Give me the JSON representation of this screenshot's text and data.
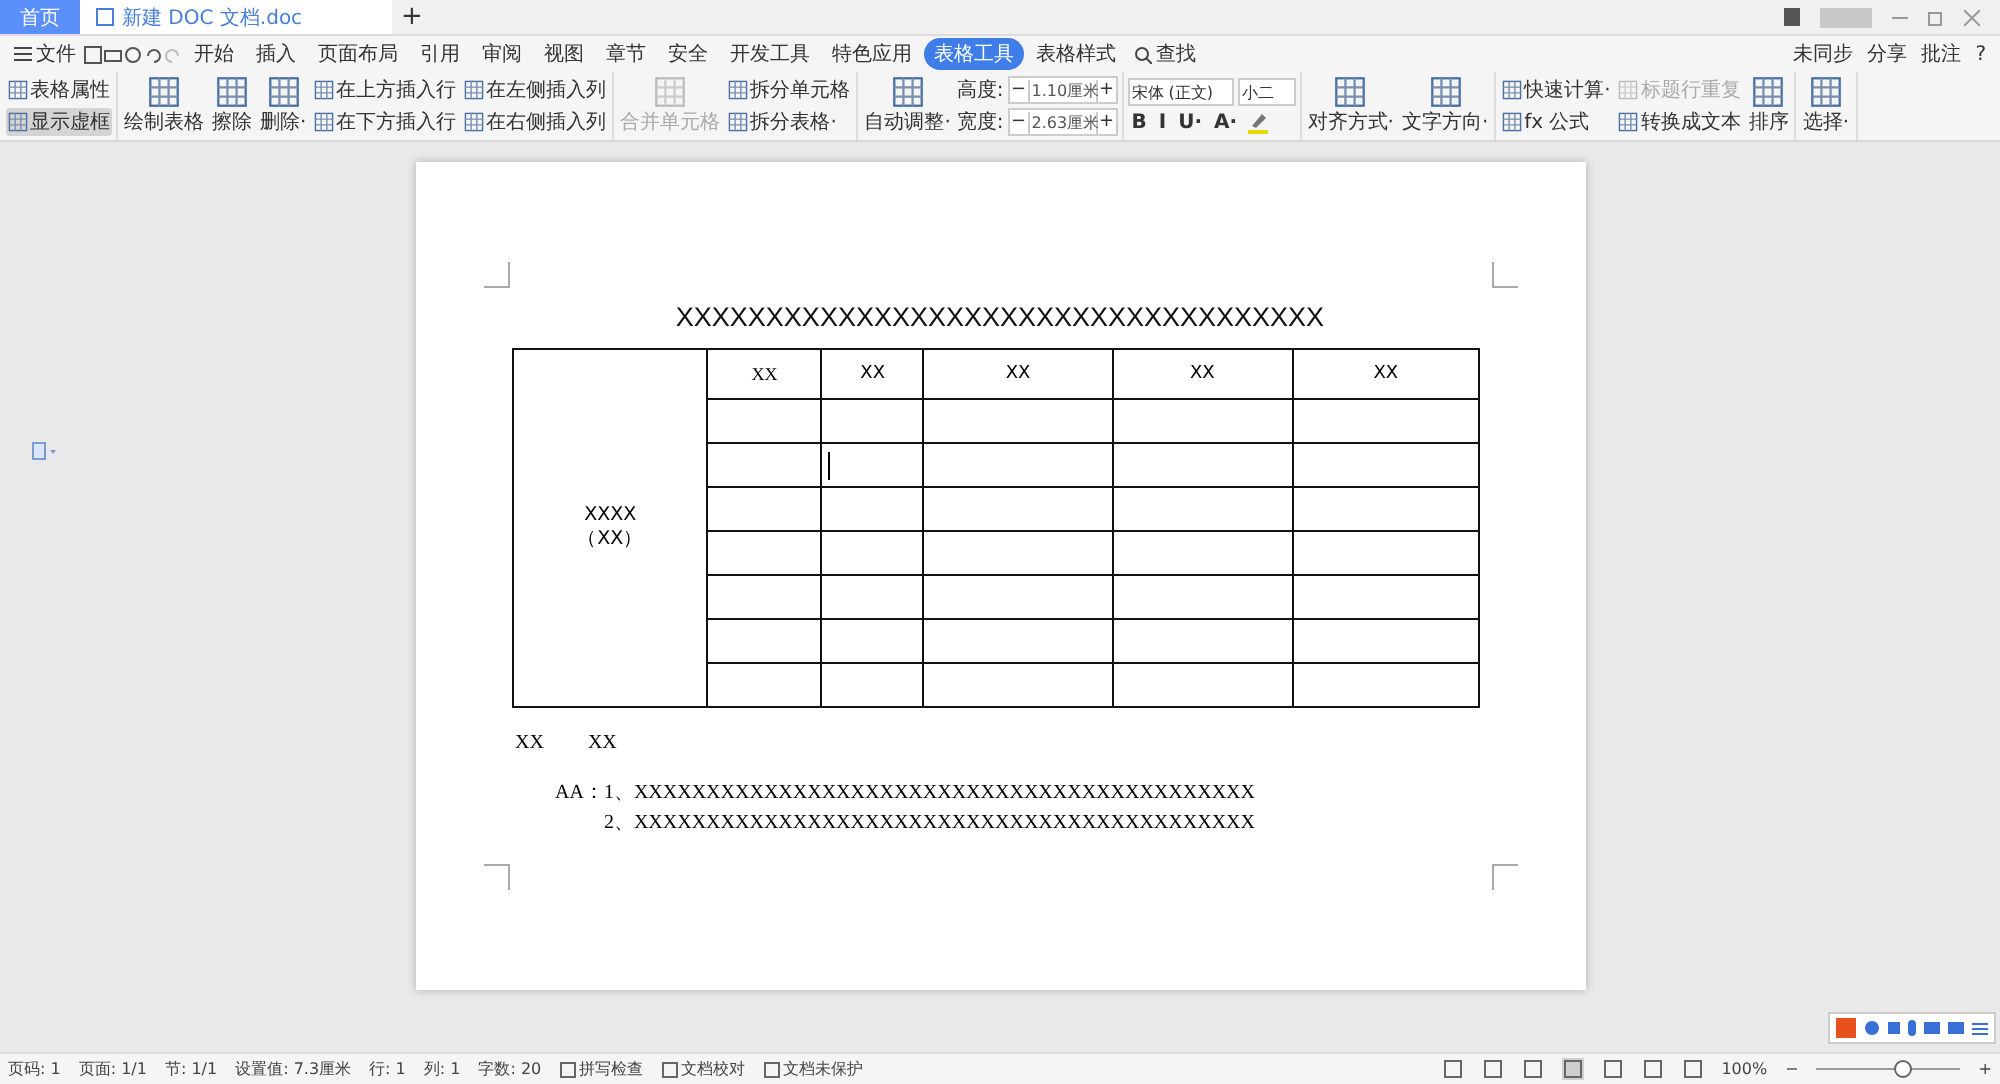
{
  "title_tabs": [
    {
      "label": "首页",
      "kind": "home",
      "selected": false
    },
    {
      "label": "新建 DOC 文档.doc",
      "kind": "doc",
      "selected": true
    }
  ],
  "new_tab": "+",
  "menu": {
    "file": "文件",
    "tabs": [
      {
        "label": "开始",
        "selected": false
      },
      {
        "label": "插入",
        "selected": false
      },
      {
        "label": "页面布局",
        "selected": false
      },
      {
        "label": "引用",
        "selected": false
      },
      {
        "label": "审阅",
        "selected": false
      },
      {
        "label": "视图",
        "selected": false
      },
      {
        "label": "章节",
        "selected": false
      },
      {
        "label": "安全",
        "selected": false
      },
      {
        "label": "开发工具",
        "selected": false
      },
      {
        "label": "特色应用",
        "selected": false
      },
      {
        "label": "表格工具",
        "selected": true
      },
      {
        "label": "表格样式",
        "selected": false
      }
    ],
    "search": "查找",
    "right": [
      "未同步",
      "分享",
      "批注"
    ],
    "help": "?"
  },
  "ribbon": [
    {
      "columns": [
        {
          "kind": "stack",
          "items": [
            {
              "label": "表格属性",
              "disabled": false,
              "pressed": false
            },
            {
              "label": "显示虚框",
              "disabled": false,
              "pressed": true
            }
          ]
        }
      ]
    },
    {
      "columns": [
        {
          "kind": "large",
          "items": [
            {
              "label": "绘制表格",
              "disabled": false,
              "pressed": false
            }
          ]
        },
        {
          "kind": "large",
          "items": [
            {
              "label": "擦除",
              "disabled": false,
              "pressed": false
            }
          ]
        },
        {
          "kind": "large",
          "items": [
            {
              "label": "删除·",
              "disabled": false,
              "pressed": false
            }
          ]
        },
        {
          "kind": "stack",
          "items": [
            {
              "label": "在上方插入行",
              "disabled": false,
              "pressed": false
            },
            {
              "label": "在下方插入行",
              "disabled": false,
              "pressed": false
            }
          ]
        },
        {
          "kind": "stack",
          "items": [
            {
              "label": "在左侧插入列",
              "disabled": false,
              "pressed": false
            },
            {
              "label": "在右侧插入列",
              "disabled": false,
              "pressed": false
            }
          ]
        }
      ]
    },
    {
      "columns": [
        {
          "kind": "large",
          "items": [
            {
              "label": "合并单元格",
              "disabled": true,
              "pressed": false
            }
          ]
        },
        {
          "kind": "stack",
          "items": [
            {
              "label": "拆分单元格",
              "disabled": false,
              "pressed": false
            },
            {
              "label": "拆分表格·",
              "disabled": false,
              "pressed": false
            }
          ]
        }
      ]
    },
    {
      "columns": [
        {
          "kind": "large",
          "items": [
            {
              "label": "自动调整·",
              "disabled": false,
              "pressed": false
            }
          ]
        },
        {
          "kind": "spinners",
          "items": [
            {
              "label": "高度:",
              "value": "1.10厘米",
              "minus": "−",
              "plus": "+"
            },
            {
              "label": "宽度:",
              "value": "2.63厘米",
              "minus": "−",
              "plus": "+"
            }
          ]
        }
      ]
    },
    {
      "columns": [
        {
          "kind": "font",
          "font": "宋体 (正文)",
          "size": "小二",
          "styles": [
            "B",
            "I",
            "U·",
            "A·"
          ]
        }
      ]
    },
    {
      "columns": [
        {
          "kind": "large",
          "items": [
            {
              "label": "对齐方式·",
              "disabled": false,
              "pressed": false
            }
          ]
        },
        {
          "kind": "large",
          "items": [
            {
              "label": "文字方向·",
              "disabled": false,
              "pressed": false
            }
          ]
        }
      ]
    },
    {
      "columns": [
        {
          "kind": "stack",
          "items": [
            {
              "label": "快速计算·",
              "disabled": false,
              "pressed": false
            },
            {
              "label": "fx 公式",
              "disabled": false,
              "pressed": false
            }
          ]
        },
        {
          "kind": "stack",
          "items": [
            {
              "label": "标题行重复",
              "disabled": true,
              "pressed": false
            },
            {
              "label": "转换成文本",
              "disabled": false,
              "pressed": false
            }
          ]
        },
        {
          "kind": "large",
          "items": [
            {
              "label": "排序",
              "disabled": false,
              "pressed": false
            }
          ]
        }
      ]
    },
    {
      "columns": [
        {
          "kind": "large",
          "items": [
            {
              "label": "选择·",
              "disabled": false,
              "pressed": false
            }
          ]
        }
      ]
    }
  ],
  "document": {
    "title": "XXXXXXXXXXXXXXXXXXXXXXXXXXXXXXXXXXXX",
    "side_cell": [
      "XXXX",
      "（XX）"
    ],
    "header": [
      "XX",
      "XX",
      "XX",
      "XX",
      "XX"
    ],
    "note": [
      "XX",
      "XX"
    ],
    "list_label": "AA：",
    "list": [
      "1、XXXXXXXXXXXXXXXXXXXXXXXXXXXXXXXXXXXXXXXXXXX",
      "2、XXXXXXXXXXXXXXXXXXXXXXXXXXXXXXXXXXXXXXXXXXX"
    ]
  },
  "status_bar": {
    "items": [
      "页码: 1",
      "页面: 1/1",
      "节: 1/1",
      "设置值: 7.3厘米",
      "行: 1",
      "列: 1",
      "字数: 20"
    ],
    "checks": [
      "拼写检查",
      "文档校对",
      "文档未保护"
    ],
    "views": [
      {
        "selected": false
      },
      {
        "selected": false
      },
      {
        "selected": false
      },
      {
        "selected": true
      },
      {
        "selected": false
      },
      {
        "selected": false
      },
      {
        "selected": false
      }
    ],
    "zoom": "100%",
    "zoom_out": "−",
    "zoom_in": "+",
    "zoom_level": {
      "level": 0.6
    }
  }
}
